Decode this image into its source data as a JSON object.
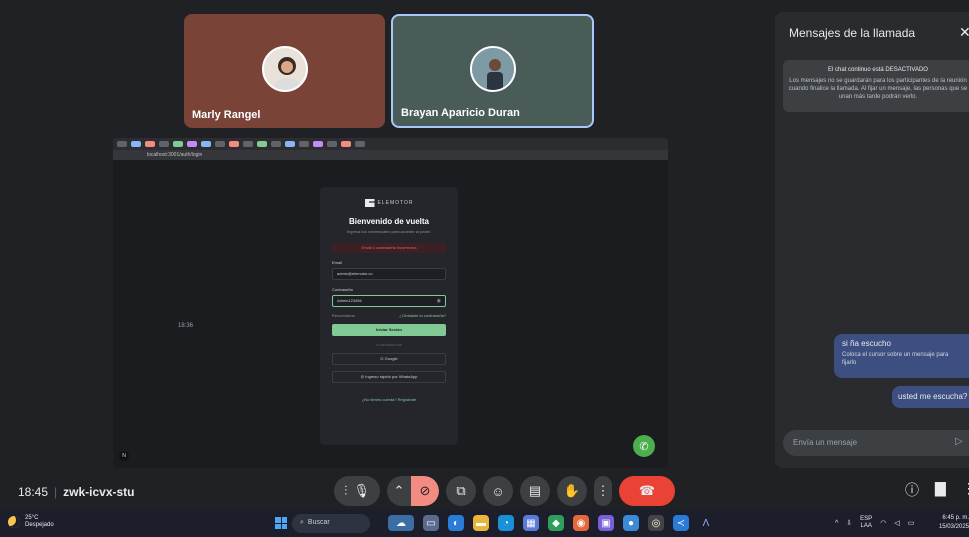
{
  "participants": [
    {
      "name": "Marly Rangel"
    },
    {
      "name": "Brayan Aparicio Duran"
    }
  ],
  "shared_screen": {
    "url": "localhost:3001/auth/login",
    "login": {
      "brand": "ELEMOTOR",
      "title": "Bienvenido de vuelta",
      "subtitle": "Ingresa tus credenciales para acceder al panel.",
      "error": "Email o contraseña incorrectos",
      "email_label": "Email",
      "email_value": "admin@elemotor.co",
      "password_label": "Contraseña",
      "password_value": "Admin123456",
      "remember": "Recuérdame",
      "forgot": "¿Olvidaste tu contraseña?",
      "login_button": "Iniciar Sesión",
      "divider": "o continúa con",
      "google_button": "Google",
      "whatsapp_button": "Ingreso rápido por WhatsApp",
      "register": "¿No tienes cuenta? Regístrate"
    },
    "badge": "N"
  },
  "call": {
    "time": "18:45",
    "meeting_code": "zwk-icvx-stu"
  },
  "chat": {
    "title": "Mensajes de la llamada",
    "notice_title": "El chat continuo está DESACTIVADO",
    "notice_body": "Los mensajes no se guardarán para los participantes de la reunión cuando finalice la llamada. Al fijar un mensaje, las personas que se unan más tarde podrán verlo.",
    "time": "18:36",
    "messages": [
      {
        "text": "si ña escucho",
        "tip": "Coloca el cursor sobre un mensaje para fijarlo"
      },
      {
        "text": "usted me escucha?"
      }
    ],
    "input_placeholder": "Envía un mensaje"
  },
  "taskbar": {
    "temperature": "25°C",
    "weather": "Despejado",
    "search_placeholder": "Buscar",
    "lang_top": "ESP",
    "lang_bottom": "LAA",
    "clock_time": "6:45 p. m.",
    "clock_date": "15/03/2025"
  },
  "colors": {
    "meet_bg": "#202124",
    "end_call": "#ea4335",
    "accent_green": "#81c995",
    "chat_bubble": "#3d4f80"
  }
}
